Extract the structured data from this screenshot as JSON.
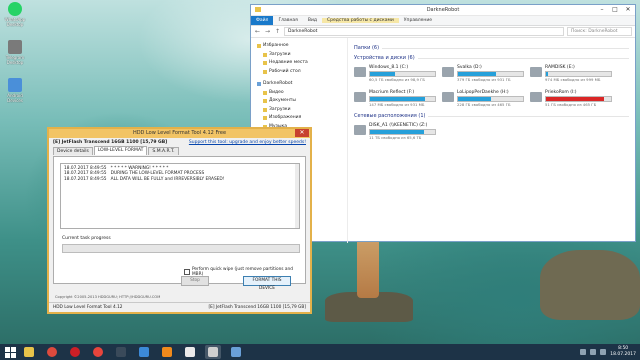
{
  "explorer": {
    "title": "DarkneRobot",
    "ribbon_tabs": [
      "Файл",
      "Главная",
      "Вид",
      "Средства работы с дисками",
      "Управление"
    ],
    "path": "DarkneRobot",
    "search_placeholder": "Поиск: DarkneRobot",
    "nav": {
      "favorites": "Избранное",
      "favorites_items": [
        "Загрузки",
        "Недавние места",
        "Рабочий стол"
      ],
      "user": "DarkneRobot",
      "user_items": [
        "Видео",
        "Документы",
        "Загрузки",
        "Изображения",
        "Музыка",
        "Рабочий стол",
        "Локальный диск"
      ]
    },
    "groups": {
      "folders": "Папки (6)",
      "devices": "Устройства и диски (6)",
      "network": "Сетевые расположения (1)"
    },
    "drives": [
      {
        "name": "Windows_8.1 (C:)",
        "free": "60,5 ГБ свободно из 98,9 ГБ",
        "used_pct": 39
      },
      {
        "name": "Svalka (D:)",
        "free": "379 ГБ свободно из 931 ГБ",
        "used_pct": 59
      },
      {
        "name": "RAMDISK (E:)",
        "free": "974 МБ свободно из 999 МБ",
        "used_pct": 3
      },
      {
        "name": "Macrium Reflect (F:)",
        "free": "147 МБ свободно из 931 МБ",
        "used_pct": 84
      },
      {
        "name": "LoLipopPerDaekhe (H:)",
        "free": "228 ГБ свободно из 465 ГБ",
        "used_pct": 51
      },
      {
        "name": "PriekoRom (I:)",
        "free": "51 ГБ свободно из 465 ГБ",
        "used_pct": 89
      }
    ],
    "network_drive": {
      "name": "DISK_A1 (\\\\KEENETIC) (Z:)",
      "free": "11 ТБ свободно из 65,6 ТБ",
      "used_pct": 83
    }
  },
  "tool": {
    "title": "HDD Low Level Format Tool 4.12   Free",
    "device": "[E]  JetFlash Transcend 16GB   1100   [15,79 GB]",
    "support_link": "Support this tool: upgrade and enjoy better speeds!",
    "tabs": [
      "Device details",
      "LOW-LEVEL FORMAT",
      "S.M.A.R.T."
    ],
    "log": [
      "18.07.2017 8:49:55   * * * * * WARNING! * * * * *",
      "18.07.2017 8:49:55   DURING THE LOW-LEVEL FORMAT PROCESS",
      "18.07.2017 8:49:55   ALL DATA WILL BE FULLY and IRREVERSIBLY ERASED!"
    ],
    "progress_label": "Current task progress",
    "progress_pct": 0,
    "quick_wipe": "Perform quick wipe (just remove partitions and MBR)",
    "stop_label": "Stop",
    "format_label": "FORMAT THIS DEVICE",
    "copyright": "Copyright ©2005-2013 HDDGURU;  HTTP://HDDGURU.COM",
    "status_left": "HDD Low Level Format Tool 4.12",
    "status_right": "[E]   JetFlash Transcend 16GB    1100    [15,79 GB]"
  },
  "desktop_icons": [
    {
      "label": "WhatsApp\nDesktop",
      "color": "#25d366"
    },
    {
      "label": "Telegram\nDesktop",
      "color": "#7a7a7a"
    },
    {
      "label": "Android\nDevices",
      "color": "#4a8fd9"
    }
  ],
  "taskbar": {
    "apps": [
      {
        "name": "explorer",
        "color": "#e8c34a"
      },
      {
        "name": "chrome",
        "color": "#dd4a3d"
      },
      {
        "name": "opera",
        "color": "#cc1f26"
      },
      {
        "name": "yandex",
        "color": "#e8453c"
      },
      {
        "name": "calculator",
        "color": "#3a4a5a"
      },
      {
        "name": "mail",
        "color": "#3c8ad8"
      },
      {
        "name": "vlc",
        "color": "#f08a1c"
      },
      {
        "name": "cpanel",
        "color": "#e9e9e9"
      },
      {
        "name": "hddtool",
        "color": "#cfcfcf"
      },
      {
        "name": "paint",
        "color": "#6aa0d8"
      }
    ],
    "clock_time": "8:50",
    "clock_date": "18.07.2017"
  }
}
